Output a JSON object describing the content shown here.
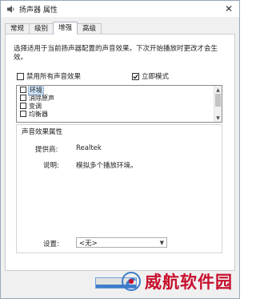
{
  "window": {
    "title": "扬声器 属性",
    "close_glyph": "✕"
  },
  "tabs": [
    {
      "label": "常规"
    },
    {
      "label": "级别"
    },
    {
      "label": "增强",
      "active": true
    },
    {
      "label": "高级"
    }
  ],
  "enhancements": {
    "description": "选择适用于当前扬声器配置的声音效果。下次开始播放时更改才会生效。",
    "disable_all_label": "禁用所有声音效果",
    "disable_all_checked": false,
    "immediate_mode_label": "立即模式",
    "immediate_mode_checked": true,
    "effects": [
      {
        "label": "环境",
        "checked": false,
        "selected": true
      },
      {
        "label": "消除原声",
        "checked": false
      },
      {
        "label": "变调",
        "checked": false
      },
      {
        "label": "均衡器",
        "checked": false
      }
    ]
  },
  "properties": {
    "title": "声音效果属性",
    "provider_label": "提供商:",
    "provider_value": "Realtek",
    "description_label": "说明:",
    "description_value": "模拟多个播放环境。",
    "settings_label": "设置:",
    "settings_value": "<无>"
  },
  "watermark": {
    "text": "威航软件园"
  },
  "colors": {
    "accent": "#3d7cc9",
    "watermark": "#c8102e"
  }
}
